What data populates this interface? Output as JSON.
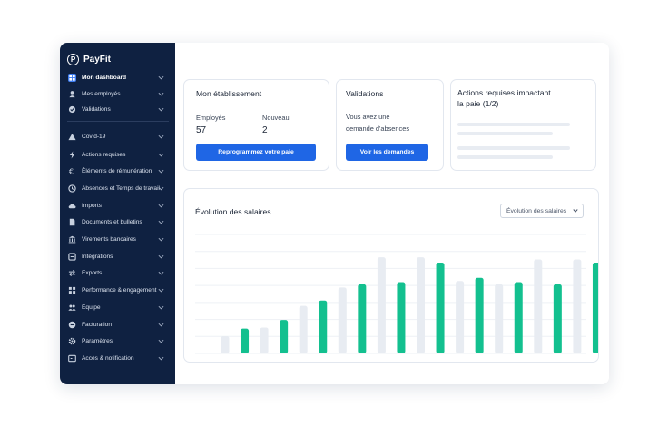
{
  "app": {
    "logo_text": "PayFit",
    "logo_mark": "P"
  },
  "sidebar": {
    "items": [
      {
        "label": "Mon dashboard",
        "icon": "dashboard-icon",
        "active": true
      },
      {
        "label": "Mes employés",
        "icon": "user-icon"
      },
      {
        "label": "Validations",
        "icon": "check-circle-icon"
      },
      {
        "label": "Covid-19",
        "icon": "warning-icon"
      },
      {
        "label": "Actions requises",
        "icon": "lightning-icon"
      },
      {
        "label": "Éléments de rémunération",
        "icon": "euro-icon"
      },
      {
        "label": "Absences et Temps de travail",
        "icon": "clock-icon"
      },
      {
        "label": "Imports",
        "icon": "cloud-upload-icon"
      },
      {
        "label": "Documents et bulletins",
        "icon": "document-icon"
      },
      {
        "label": "Virements bancaires",
        "icon": "bank-icon"
      },
      {
        "label": "Intégrations",
        "icon": "integration-icon"
      },
      {
        "label": "Exports",
        "icon": "exchange-icon"
      },
      {
        "label": "Performance & engagement",
        "icon": "grid-icon"
      },
      {
        "label": "Équipe",
        "icon": "team-icon"
      },
      {
        "label": "Facturation",
        "icon": "billing-icon"
      },
      {
        "label": "Paramètres",
        "icon": "gear-icon"
      },
      {
        "label": "Accès & notification",
        "icon": "access-icon"
      }
    ]
  },
  "etablissement": {
    "title": "Mon établissement",
    "employes_label": "Employés",
    "employes_value": "57",
    "nouveau_label": "Nouveau",
    "nouveau_value": "2",
    "button": "Reprogrammez votre paie"
  },
  "validations": {
    "title": "Validations",
    "text_line1": "Vous avez une",
    "text_line2": "demande d'absences",
    "button": "Voir les demandes"
  },
  "actions": {
    "title_line1": "Actions requises impactant",
    "title_line2": "la paie (1/2)"
  },
  "salaires": {
    "title": "Évolution des salaires",
    "select_value": "Évolution des salaires"
  },
  "colors": {
    "sidebar_bg": "#0f2141",
    "accent": "#1f66e5",
    "bar_green": "#13c08f",
    "bar_gray": "#e8ecf2"
  },
  "chart_data": {
    "type": "bar",
    "series": [
      {
        "values": [
          0.16,
          0.24,
          0.44,
          0.61,
          0.89,
          0.89,
          0.67,
          0.64,
          0.87,
          0.87
        ]
      },
      {
        "values": [
          0.23,
          0.31,
          0.49,
          0.64,
          0.66,
          0.84,
          0.7,
          0.66,
          0.64,
          0.84
        ]
      }
    ],
    "ylim": [
      0,
      1
    ],
    "grid": true,
    "legend": "none"
  }
}
